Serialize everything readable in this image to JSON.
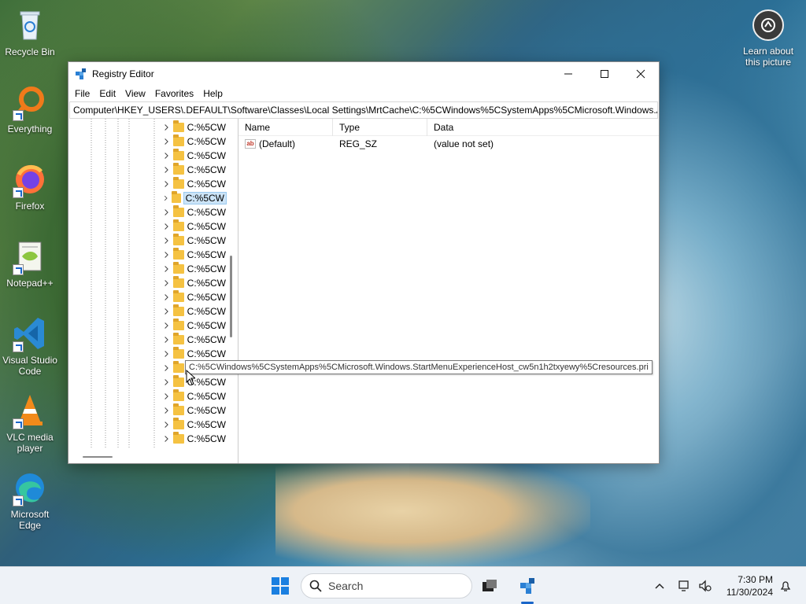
{
  "desktop": {
    "icons": [
      {
        "label": "Recycle Bin",
        "icon": "recycle-bin-icon"
      },
      {
        "label": "Everything",
        "icon": "everything-search-icon"
      },
      {
        "label": "Firefox",
        "icon": "firefox-icon"
      },
      {
        "label": "Notepad++",
        "icon": "notepad-plus-plus-icon"
      },
      {
        "label": "Visual Studio Code",
        "icon": "vscode-icon"
      },
      {
        "label": "VLC media player",
        "icon": "vlc-icon"
      },
      {
        "label": "Microsoft Edge",
        "icon": "edge-icon"
      }
    ],
    "learn": {
      "label": "Learn about this picture",
      "icon": "camera-circle-icon"
    }
  },
  "window": {
    "title": "Registry Editor",
    "menu": [
      "File",
      "Edit",
      "View",
      "Favorites",
      "Help"
    ],
    "address": "Computer\\HKEY_USERS\\.DEFAULT\\Software\\Classes\\Local Settings\\MrtCache\\C:%5CWindows%5CSystemApps%5CMicrosoft.Windows.AppR",
    "tree_items": [
      "C:%5CW",
      "C:%5CW",
      "C:%5CW",
      "C:%5CW",
      "C:%5CW",
      "C:%5CW",
      "C:%5CW",
      "C:%5CW",
      "C:%5CW",
      "C:%5CW",
      "C:%5CW",
      "C:%5CW",
      "C:%5CW",
      "C:%5CW",
      "C:%5CW",
      "C:%5CW",
      "C:%5CW",
      "C:%5CW",
      "C:%5CW",
      "C:%5CW",
      "C:%5CW",
      "C:%5CW",
      "C:%5CW"
    ],
    "tree_selected_index": 5,
    "columns": {
      "name": "Name",
      "type": "Type",
      "data": "Data"
    },
    "values": [
      {
        "name": "(Default)",
        "type": "REG_SZ",
        "data": "(value not set)"
      }
    ],
    "tooltip": "C:%5CWindows%5CSystemApps%5CMicrosoft.Windows.StartMenuExperienceHost_cw5n1h2txyewy%5Cresources.pri"
  },
  "taskbar": {
    "search_placeholder": "Search",
    "time": "7:30 PM",
    "date": "11/30/2024"
  }
}
